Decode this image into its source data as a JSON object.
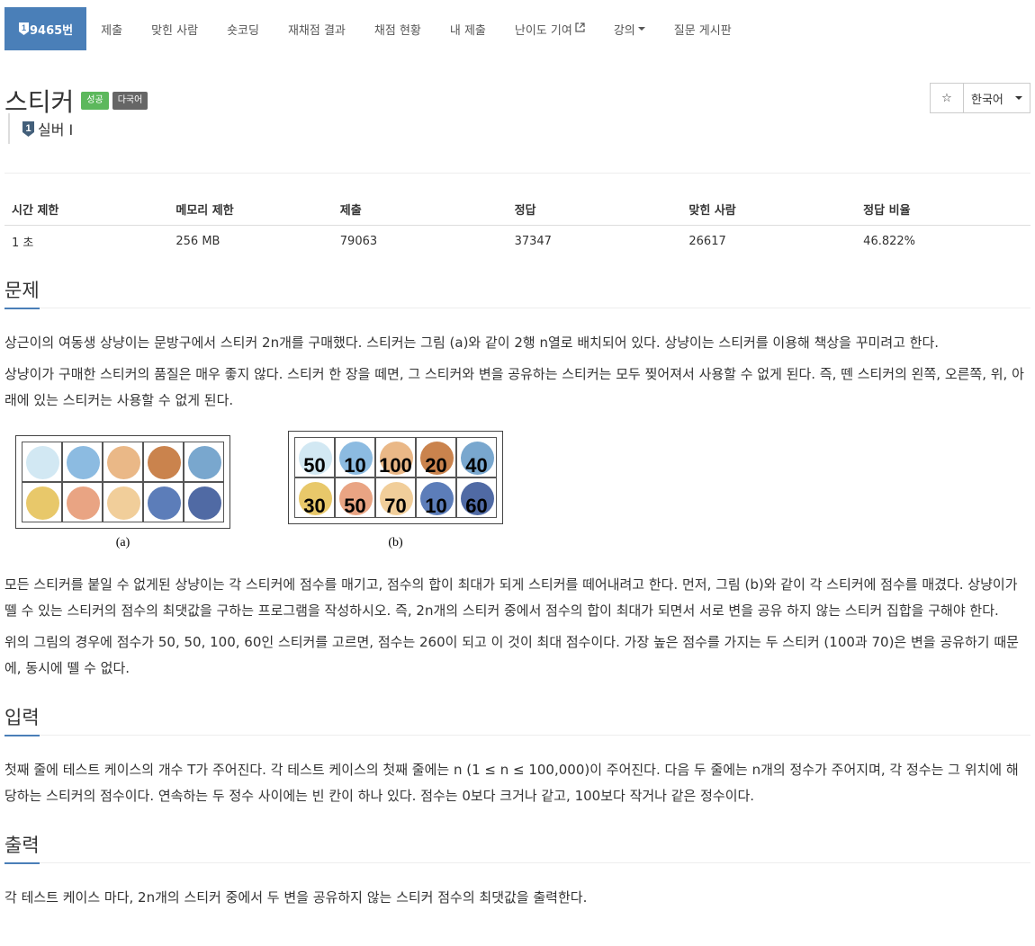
{
  "nav": {
    "problem_no": "9465번",
    "items": [
      "제출",
      "맞힌 사람",
      "숏코딩",
      "재채점 결과",
      "채점 현황",
      "내 제출",
      "난이도 기여",
      "강의",
      "질문 게시판"
    ]
  },
  "problem": {
    "title": "스티커",
    "labels": {
      "success": "성공",
      "multilang": "다국어"
    },
    "tier": {
      "number": "1",
      "name": "실버 I"
    },
    "star": "☆",
    "language": "한국어"
  },
  "info": {
    "headers": [
      "시간 제한",
      "메모리 제한",
      "제출",
      "정답",
      "맞힌 사람",
      "정답 비율"
    ],
    "values": [
      "1 초",
      "256 MB",
      "79063",
      "37347",
      "26617",
      "46.822%"
    ]
  },
  "sections": {
    "problem": {
      "title": "문제",
      "p1": "상근이의 여동생 상냥이는 문방구에서 스티커 2n개를 구매했다. 스티커는 그림 (a)와 같이 2행 n열로 배치되어 있다. 상냥이는 스티커를 이용해 책상을 꾸미려고 한다.",
      "p2": "상냥이가 구매한 스티커의 품질은 매우 좋지 않다. 스티커 한 장을 떼면, 그 스티커와 변을 공유하는 스티커는 모두 찢어져서 사용할 수 없게 된다. 즉, 뗀 스티커의 왼쪽, 오른쪽, 위, 아래에 있는 스티커는 사용할 수 없게 된다.",
      "fig_a_caption": "(a)",
      "fig_b_caption": "(b)",
      "fig_b_numbers": [
        "50",
        "10",
        "100",
        "20",
        "40",
        "30",
        "50",
        "70",
        "10",
        "60"
      ],
      "p3": "모든 스티커를 붙일 수 없게된 상냥이는 각 스티커에 점수를 매기고, 점수의 합이 최대가 되게 스티커를 떼어내려고 한다. 먼저, 그림 (b)와 같이 각 스티커에 점수를 매겼다. 상냥이가 뗄 수 있는 스티커의 점수의 최댓값을 구하는 프로그램을 작성하시오. 즉, 2n개의 스티커 중에서 점수의 합이 최대가 되면서 서로 변을 공유 하지 않는 스티커 집합을 구해야 한다.",
      "p4": "위의 그림의 경우에 점수가 50, 50, 100, 60인 스티커를 고르면, 점수는 260이 되고 이 것이 최대 점수이다. 가장 높은 점수를 가지는 두 스티커 (100과 70)은 변을 공유하기 때문에, 동시에 뗄 수 없다."
    },
    "input": {
      "title": "입력",
      "p1": "첫째 줄에 테스트 케이스의 개수 T가 주어진다. 각 테스트 케이스의 첫째 줄에는 n (1 ≤ n ≤ 100,000)이 주어진다. 다음 두 줄에는 n개의 정수가 주어지며, 각 정수는 그 위치에 해당하는 스티커의 점수이다. 연속하는 두 정수 사이에는 빈 칸이 하나 있다. 점수는 0보다 크거나 같고, 100보다 작거나 같은 정수이다."
    },
    "output": {
      "title": "출력",
      "p1": "각 테스트 케이스 마다, 2n개의 스티커 중에서 두 변을 공유하지 않는 스티커 점수의 최댓값을 출력한다."
    }
  },
  "colors": {
    "accent": "#4a7fb8",
    "success": "#5cb85c",
    "tier_silver": "#435f7a"
  }
}
